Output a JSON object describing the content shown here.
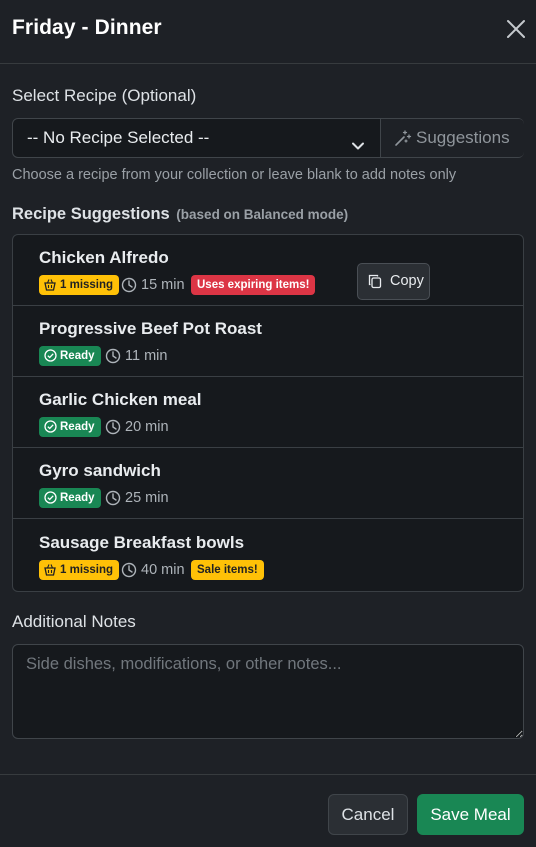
{
  "modal": {
    "title": "Friday - Dinner"
  },
  "recipe_select": {
    "label": "Select Recipe (Optional)",
    "value": "-- No Recipe Selected --",
    "suggestions_button": "Suggestions",
    "help_text": "Choose a recipe from your collection or leave blank to add notes only"
  },
  "suggestions": {
    "heading": "Recipe Suggestions",
    "subheading": "(based on Balanced mode)",
    "copy_label": "Copy",
    "items": [
      {
        "name": "Chicken Alfredo",
        "status": "1 missing",
        "status_type": "missing",
        "time": "15 min",
        "tag": "Uses expiring items!",
        "tag_type": "expiring"
      },
      {
        "name": "Progressive Beef Pot Roast",
        "status": "Ready",
        "status_type": "ready",
        "time": "11 min",
        "tag": "",
        "tag_type": ""
      },
      {
        "name": "Garlic Chicken meal",
        "status": "Ready",
        "status_type": "ready",
        "time": "20 min",
        "tag": "",
        "tag_type": ""
      },
      {
        "name": "Gyro sandwich",
        "status": "Ready",
        "status_type": "ready",
        "time": "25 min",
        "tag": "",
        "tag_type": ""
      },
      {
        "name": "Sausage Breakfast bowls",
        "status": "1 missing",
        "status_type": "missing",
        "time": "40 min",
        "tag": "Sale items!",
        "tag_type": "sale"
      }
    ]
  },
  "notes": {
    "label": "Additional Notes",
    "placeholder": "Side dishes, modifications, or other notes..."
  },
  "footer": {
    "cancel_label": "Cancel",
    "save_label": "Save Meal"
  },
  "colors": {
    "success": "#198754",
    "warning": "#ffc107",
    "danger": "#dc3545",
    "background": "#1e2126"
  }
}
